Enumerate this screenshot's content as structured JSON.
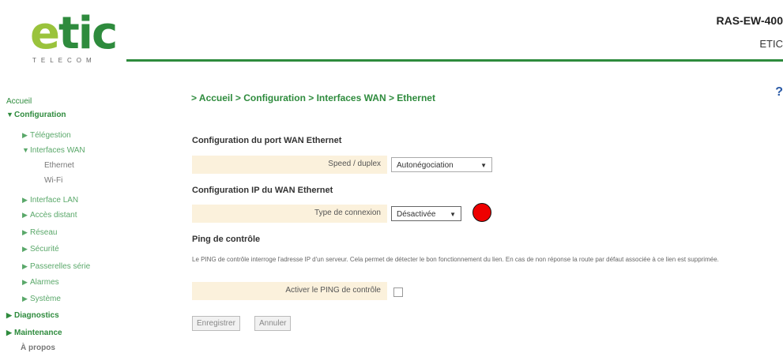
{
  "header": {
    "logo_main": "etic",
    "logo_sub": "TELECOM",
    "product": "RAS-EW-400",
    "vendor": "ETIC",
    "accent": "#2e8b3d"
  },
  "sidebar": {
    "accueil": "Accueil",
    "configuration": "Configuration",
    "telegestion": "Télégestion",
    "interfaces_wan": "Interfaces WAN",
    "ethernet": "Ethernet",
    "wifi": "Wi-Fi",
    "interface_lan": "Interface LAN",
    "acces_distant": "Accès distant",
    "reseau": "Réseau",
    "securite": "Sécurité",
    "passerelles_serie": "Passerelles série",
    "alarmes": "Alarmes",
    "systeme": "Système",
    "diagnostics": "Diagnostics",
    "maintenance": "Maintenance",
    "a_propos": "À propos"
  },
  "main": {
    "breadcrumb": "> Accueil > Configuration > Interfaces WAN > Ethernet",
    "help_icon": "?",
    "section_port": "Configuration du port WAN Ethernet",
    "speed_label": "Speed / duplex",
    "speed_value": "Autonégociation",
    "section_ip": "Configuration IP du WAN Ethernet",
    "type_label": "Type de connexion",
    "type_value": "Désactivée",
    "section_ping": "Ping de contrôle",
    "ping_desc": "Le PING de contrôle interroge l'adresse IP d'un serveur. Cela permet de détecter le bon fonctionnement du lien. En cas de non réponse la route par défaut associée à ce lien est supprimée.",
    "ping_label": "Activer le PING de contrôle",
    "ping_checked": false,
    "save_button": "Enregistrer",
    "cancel_button": "Annuler"
  }
}
